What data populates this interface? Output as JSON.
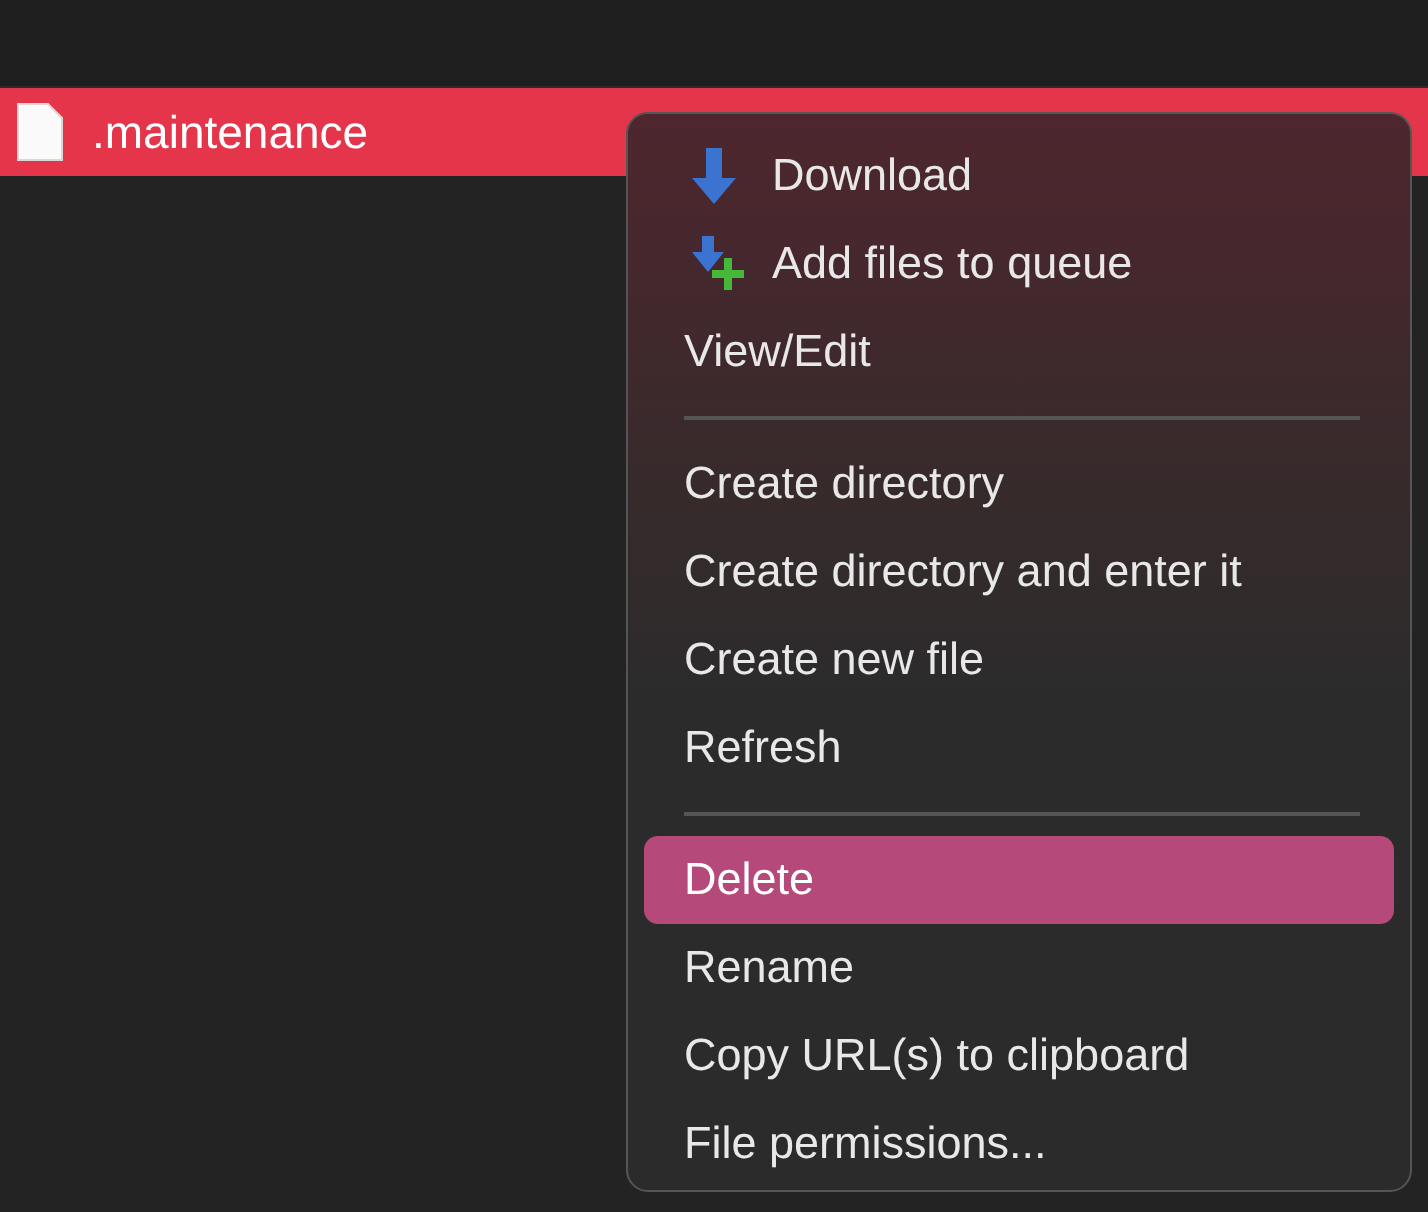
{
  "file_list": {
    "rows": [
      {
        "name": ".maintenance",
        "selected": true
      }
    ]
  },
  "context_menu": {
    "items": [
      {
        "kind": "download",
        "label": "Download",
        "selected": false
      },
      {
        "kind": "queue",
        "label": "Add files to queue",
        "selected": false
      },
      {
        "kind": "item",
        "label": "View/Edit",
        "selected": false
      },
      {
        "kind": "separator"
      },
      {
        "kind": "item",
        "label": "Create directory",
        "selected": false
      },
      {
        "kind": "item",
        "label": "Create directory and enter it",
        "selected": false
      },
      {
        "kind": "item",
        "label": "Create new file",
        "selected": false
      },
      {
        "kind": "item",
        "label": "Refresh",
        "selected": false
      },
      {
        "kind": "separator"
      },
      {
        "kind": "item",
        "label": "Delete",
        "selected": true
      },
      {
        "kind": "item",
        "label": "Rename",
        "selected": false
      },
      {
        "kind": "item",
        "label": "Copy URL(s) to clipboard",
        "selected": false
      },
      {
        "kind": "item",
        "label": "File permissions...",
        "selected": false
      }
    ]
  }
}
